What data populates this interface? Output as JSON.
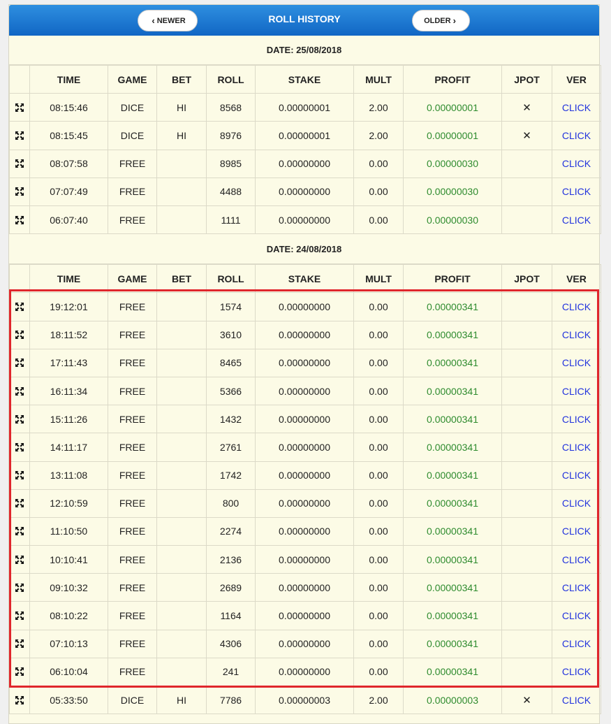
{
  "header": {
    "title": "ROLL HISTORY",
    "newer_label": "NEWER",
    "older_label": "OLDER"
  },
  "columns": [
    "",
    "TIME",
    "GAME",
    "BET",
    "ROLL",
    "STAKE",
    "MULT",
    "PROFIT",
    "JPOT",
    "VER"
  ],
  "sections": [
    {
      "date": "DATE: 25/08/2018",
      "rows": [
        {
          "time": "08:15:46",
          "game": "DICE",
          "bet": "HI",
          "roll": "8568",
          "stake": "0.00000001",
          "mult": "2.00",
          "profit": "0.00000001",
          "jpot": "✕",
          "ver": "CLICK"
        },
        {
          "time": "08:15:45",
          "game": "DICE",
          "bet": "HI",
          "roll": "8976",
          "stake": "0.00000001",
          "mult": "2.00",
          "profit": "0.00000001",
          "jpot": "✕",
          "ver": "CLICK"
        },
        {
          "time": "08:07:58",
          "game": "FREE",
          "bet": "",
          "roll": "8985",
          "stake": "0.00000000",
          "mult": "0.00",
          "profit": "0.00000030",
          "jpot": "",
          "ver": "CLICK"
        },
        {
          "time": "07:07:49",
          "game": "FREE",
          "bet": "",
          "roll": "4488",
          "stake": "0.00000000",
          "mult": "0.00",
          "profit": "0.00000030",
          "jpot": "",
          "ver": "CLICK"
        },
        {
          "time": "06:07:40",
          "game": "FREE",
          "bet": "",
          "roll": "1111",
          "stake": "0.00000000",
          "mult": "0.00",
          "profit": "0.00000030",
          "jpot": "",
          "ver": "CLICK"
        }
      ]
    },
    {
      "date": "DATE: 24/08/2018",
      "rows": [
        {
          "time": "19:12:01",
          "game": "FREE",
          "bet": "",
          "roll": "1574",
          "stake": "0.00000000",
          "mult": "0.00",
          "profit": "0.00000341",
          "jpot": "",
          "ver": "CLICK"
        },
        {
          "time": "18:11:52",
          "game": "FREE",
          "bet": "",
          "roll": "3610",
          "stake": "0.00000000",
          "mult": "0.00",
          "profit": "0.00000341",
          "jpot": "",
          "ver": "CLICK"
        },
        {
          "time": "17:11:43",
          "game": "FREE",
          "bet": "",
          "roll": "8465",
          "stake": "0.00000000",
          "mult": "0.00",
          "profit": "0.00000341",
          "jpot": "",
          "ver": "CLICK"
        },
        {
          "time": "16:11:34",
          "game": "FREE",
          "bet": "",
          "roll": "5366",
          "stake": "0.00000000",
          "mult": "0.00",
          "profit": "0.00000341",
          "jpot": "",
          "ver": "CLICK"
        },
        {
          "time": "15:11:26",
          "game": "FREE",
          "bet": "",
          "roll": "1432",
          "stake": "0.00000000",
          "mult": "0.00",
          "profit": "0.00000341",
          "jpot": "",
          "ver": "CLICK"
        },
        {
          "time": "14:11:17",
          "game": "FREE",
          "bet": "",
          "roll": "2761",
          "stake": "0.00000000",
          "mult": "0.00",
          "profit": "0.00000341",
          "jpot": "",
          "ver": "CLICK"
        },
        {
          "time": "13:11:08",
          "game": "FREE",
          "bet": "",
          "roll": "1742",
          "stake": "0.00000000",
          "mult": "0.00",
          "profit": "0.00000341",
          "jpot": "",
          "ver": "CLICK"
        },
        {
          "time": "12:10:59",
          "game": "FREE",
          "bet": "",
          "roll": "800",
          "stake": "0.00000000",
          "mult": "0.00",
          "profit": "0.00000341",
          "jpot": "",
          "ver": "CLICK"
        },
        {
          "time": "11:10:50",
          "game": "FREE",
          "bet": "",
          "roll": "2274",
          "stake": "0.00000000",
          "mult": "0.00",
          "profit": "0.00000341",
          "jpot": "",
          "ver": "CLICK"
        },
        {
          "time": "10:10:41",
          "game": "FREE",
          "bet": "",
          "roll": "2136",
          "stake": "0.00000000",
          "mult": "0.00",
          "profit": "0.00000341",
          "jpot": "",
          "ver": "CLICK"
        },
        {
          "time": "09:10:32",
          "game": "FREE",
          "bet": "",
          "roll": "2689",
          "stake": "0.00000000",
          "mult": "0.00",
          "profit": "0.00000341",
          "jpot": "",
          "ver": "CLICK"
        },
        {
          "time": "08:10:22",
          "game": "FREE",
          "bet": "",
          "roll": "1164",
          "stake": "0.00000000",
          "mult": "0.00",
          "profit": "0.00000341",
          "jpot": "",
          "ver": "CLICK"
        },
        {
          "time": "07:10:13",
          "game": "FREE",
          "bet": "",
          "roll": "4306",
          "stake": "0.00000000",
          "mult": "0.00",
          "profit": "0.00000341",
          "jpot": "",
          "ver": "CLICK"
        },
        {
          "time": "06:10:04",
          "game": "FREE",
          "bet": "",
          "roll": "241",
          "stake": "0.00000000",
          "mult": "0.00",
          "profit": "0.00000341",
          "jpot": "",
          "ver": "CLICK"
        },
        {
          "time": "05:33:50",
          "game": "DICE",
          "bet": "HI",
          "roll": "7786",
          "stake": "0.00000003",
          "mult": "2.00",
          "profit": "0.00000003",
          "jpot": "✕",
          "ver": "CLICK"
        }
      ]
    }
  ],
  "colors": {
    "header_blue": "#1a78d6",
    "panel_bg": "#fcfbe6",
    "profit_green": "#2e8b2e",
    "link_blue": "#2233dd",
    "highlight_red": "#e0262c"
  },
  "icons": {
    "row_icon": "expand-arrows-icon",
    "jpot_mark": "x-mark-icon"
  }
}
